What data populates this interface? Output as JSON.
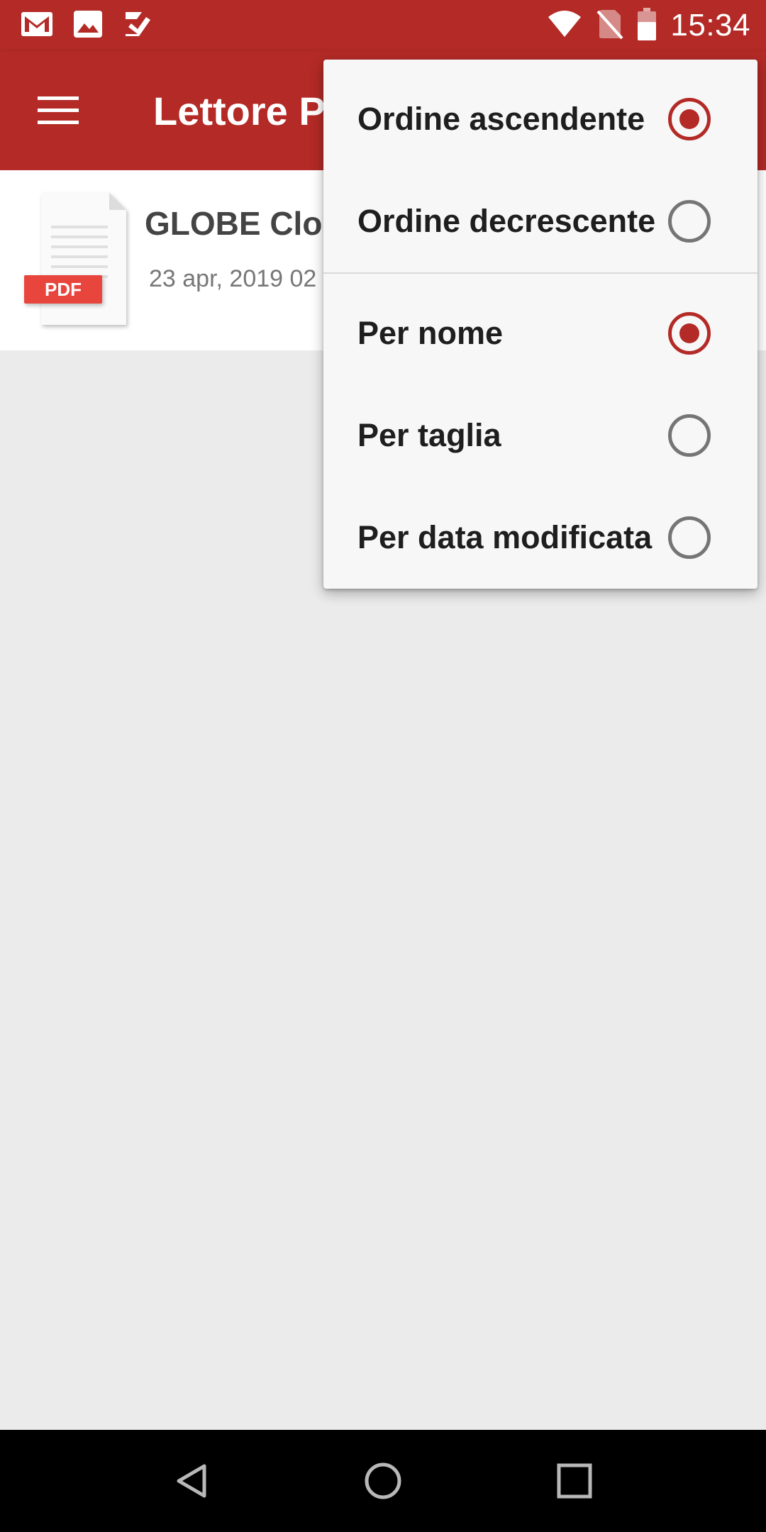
{
  "status_bar": {
    "time": "15:34",
    "left_icons": [
      "gmail-icon",
      "gallery-icon",
      "tasks-icon"
    ],
    "right_icons": [
      "wifi-icon",
      "no-sim-icon",
      "battery-icon"
    ]
  },
  "app_bar": {
    "title": "Lettore PDF",
    "menu_icon": "hamburger-menu-icon"
  },
  "files": [
    {
      "name": "GLOBE Clouds",
      "date": "23 apr, 2019 02",
      "badge": "PDF"
    }
  ],
  "sort_menu": {
    "order_options": [
      {
        "label": "Ordine ascendente",
        "checked": true
      },
      {
        "label": "Ordine decrescente",
        "checked": false
      }
    ],
    "field_options": [
      {
        "label": "Per nome",
        "checked": true
      },
      {
        "label": "Per taglia",
        "checked": false
      },
      {
        "label": "Per data modificata",
        "checked": false
      }
    ]
  },
  "nav_bar": {
    "buttons": [
      "back-icon",
      "home-icon",
      "recents-icon"
    ]
  },
  "colors": {
    "primary": "#b32a26",
    "background": "#ebebeb",
    "menu": "#f7f7f7",
    "badge": "#e8453c"
  }
}
